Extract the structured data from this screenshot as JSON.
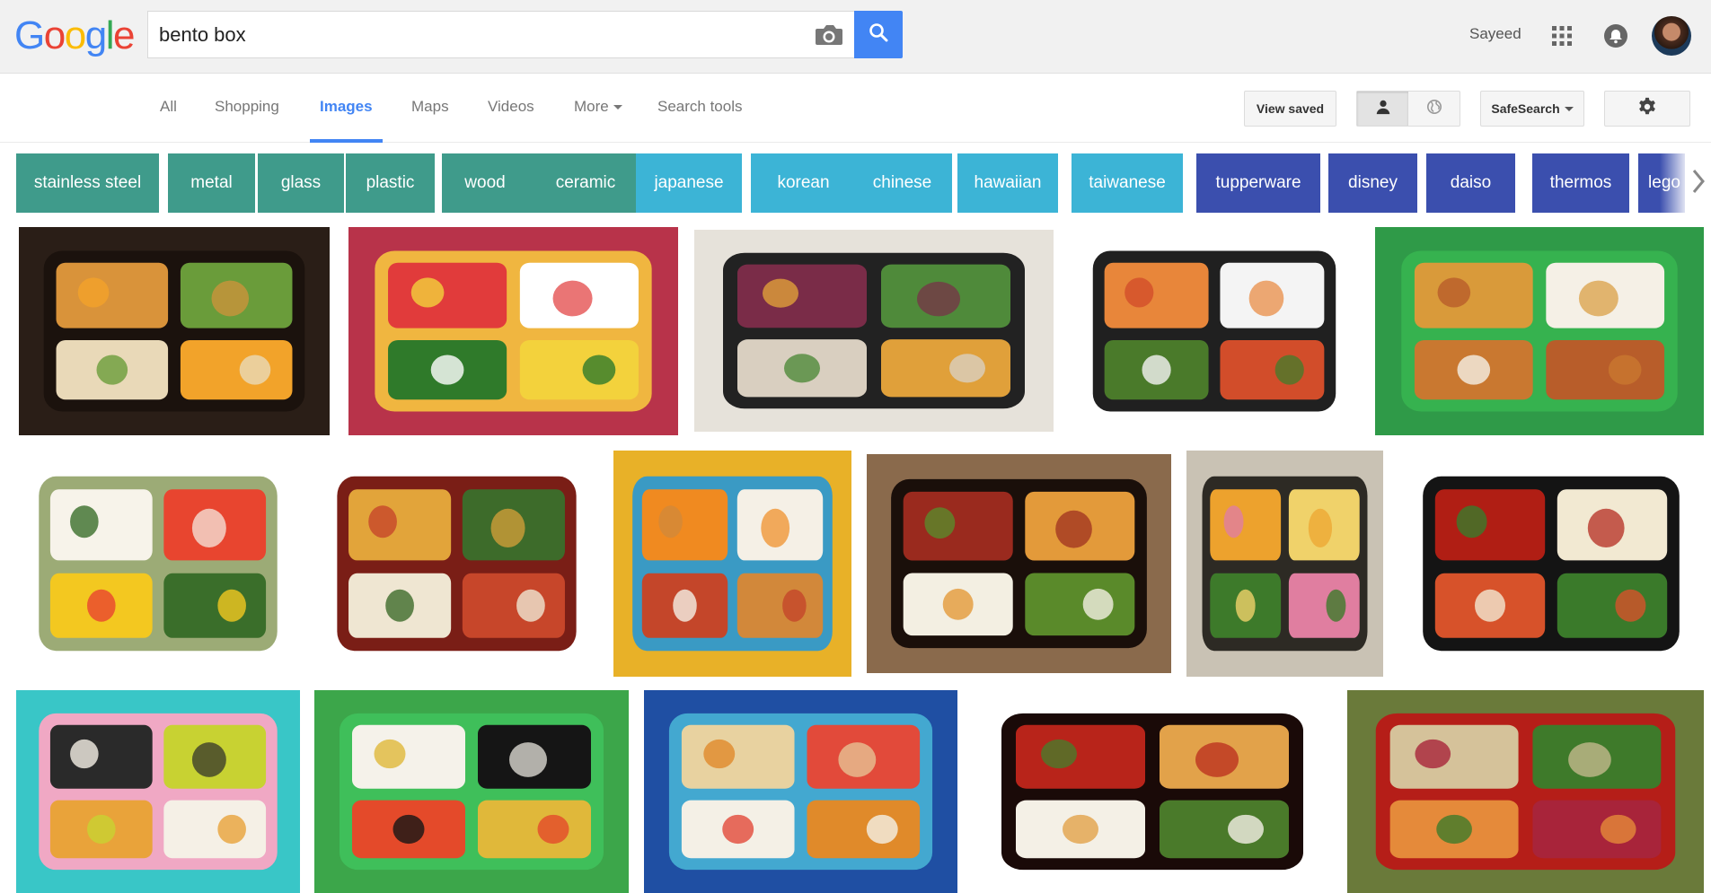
{
  "header": {
    "logo_letters": [
      {
        "char": "G",
        "color": "#4285f4"
      },
      {
        "char": "o",
        "color": "#ea4335"
      },
      {
        "char": "o",
        "color": "#fbbc05"
      },
      {
        "char": "g",
        "color": "#4285f4"
      },
      {
        "char": "l",
        "color": "#34a853"
      },
      {
        "char": "e",
        "color": "#ea4335"
      }
    ],
    "search_query": "bento box",
    "username": "Sayeed"
  },
  "nav": {
    "tabs": [
      {
        "label": "All"
      },
      {
        "label": "Shopping"
      },
      {
        "label": "Images",
        "active": true
      },
      {
        "label": "Maps"
      },
      {
        "label": "Videos"
      },
      {
        "label": "More"
      },
      {
        "label": "Search tools"
      }
    ],
    "view_saved": "View saved",
    "safesearch": "SafeSearch"
  },
  "chips": [
    {
      "label": "stainless steel",
      "color": "#3f9b8b"
    },
    {
      "label": "metal",
      "color": "#3f9b8b"
    },
    {
      "label": "glass",
      "color": "#3f9b8b"
    },
    {
      "label": "plastic",
      "color": "#3f9b8b"
    },
    {
      "label": "wood",
      "color": "#3f9b8b"
    },
    {
      "label": "ceramic",
      "color": "#3f9b8b"
    },
    {
      "label": "japanese",
      "color": "#3cb4d6"
    },
    {
      "label": "korean",
      "color": "#3cb4d6"
    },
    {
      "label": "chinese",
      "color": "#3cb4d6"
    },
    {
      "label": "hawaiian",
      "color": "#3cb4d6"
    },
    {
      "label": "taiwanese",
      "color": "#3cb4d6"
    },
    {
      "label": "tupperware",
      "color": "#3b4fae"
    },
    {
      "label": "disney",
      "color": "#3b4fae"
    },
    {
      "label": "daiso",
      "color": "#3b4fae"
    },
    {
      "label": "thermos",
      "color": "#3b4fae"
    },
    {
      "label": "lego",
      "color": "#3b4fae"
    }
  ],
  "images": [
    {
      "name": "bento-image-1",
      "bg": "#2a1e17",
      "tray": "#1b120d",
      "food": [
        "#d9933a",
        "#6a9c3a",
        "#e9d9b8",
        "#f2a32a"
      ]
    },
    {
      "name": "bento-image-2",
      "bg": "#b8334a",
      "tray": "#f0b640",
      "food": [
        "#e13b3b",
        "#ffffff",
        "#2f7a2a",
        "#f3d23c"
      ]
    },
    {
      "name": "bento-image-3",
      "bg": "#e6e2da",
      "tray": "#222222",
      "food": [
        "#7a2c48",
        "#4f8a3a",
        "#d9cfc0",
        "#e0a03a"
      ]
    },
    {
      "name": "bento-image-4",
      "bg": "#ffffff",
      "tray": "#202020",
      "food": [
        "#e8863a",
        "#f4f4f4",
        "#4a7a2a",
        "#d24d2a"
      ]
    },
    {
      "name": "bento-image-5",
      "bg": "#2f9a48",
      "tray": "#36b24f",
      "food": [
        "#d99a3a",
        "#f5f0e6",
        "#c97830",
        "#b85d2a"
      ]
    },
    {
      "name": "bento-image-6",
      "bg": "#ffffff",
      "tray": "#9cab76",
      "food": [
        "#f7f3ea",
        "#e8452f",
        "#f3c820",
        "#3a6e2a"
      ]
    },
    {
      "name": "bento-image-7",
      "bg": "#ffffff",
      "tray": "#7a1e16",
      "food": [
        "#e2a43a",
        "#3d6b2a",
        "#efe6d2",
        "#c7462a"
      ]
    },
    {
      "name": "bento-image-8",
      "bg": "#e8b128",
      "tray": "#3a9ac4",
      "food": [
        "#f08a20",
        "#f5f0e6",
        "#c4462a",
        "#d2883a"
      ]
    },
    {
      "name": "bento-image-9",
      "bg": "#8a6a4c",
      "tray": "#1a0f0a",
      "food": [
        "#9a2a1e",
        "#e39a3a",
        "#f3efe2",
        "#5a8a2a"
      ]
    },
    {
      "name": "bento-image-10",
      "bg": "#c9c2b4",
      "tray": "#2d2a24",
      "food": [
        "#eda22d",
        "#f0d26a",
        "#3d7a2a",
        "#e07ea0"
      ]
    },
    {
      "name": "bento-image-11",
      "bg": "#ffffff",
      "tray": "#141414",
      "food": [
        "#b01e14",
        "#f2e9d2",
        "#d7522a",
        "#3a7a2a"
      ]
    },
    {
      "name": "bento-image-12",
      "bg": "#39c6c7",
      "tray": "#f0a8c4",
      "food": [
        "#2a2a2a",
        "#c8d232",
        "#e9a33a",
        "#f5f0e6"
      ]
    },
    {
      "name": "bento-image-13",
      "bg": "#3ca64a",
      "tray": "#3fbf5a",
      "food": [
        "#f5f2ea",
        "#151515",
        "#e44a2a",
        "#e0b83a"
      ]
    },
    {
      "name": "bento-image-14",
      "bg": "#1f4fa3",
      "tray": "#43a8d0",
      "food": [
        "#e8d2a0",
        "#e24a3a",
        "#f4f0e6",
        "#e08a2a"
      ]
    },
    {
      "name": "bento-image-15",
      "bg": "#ffffff",
      "tray": "#1a0a08",
      "food": [
        "#b8241a",
        "#e2a24a",
        "#f4f0e6",
        "#4a7a2a"
      ]
    },
    {
      "name": "bento-image-16",
      "bg": "#6a7a3a",
      "tray": "#b51e18",
      "food": [
        "#d5c29a",
        "#3e7a2a",
        "#e58a3a",
        "#a8243a"
      ]
    }
  ]
}
